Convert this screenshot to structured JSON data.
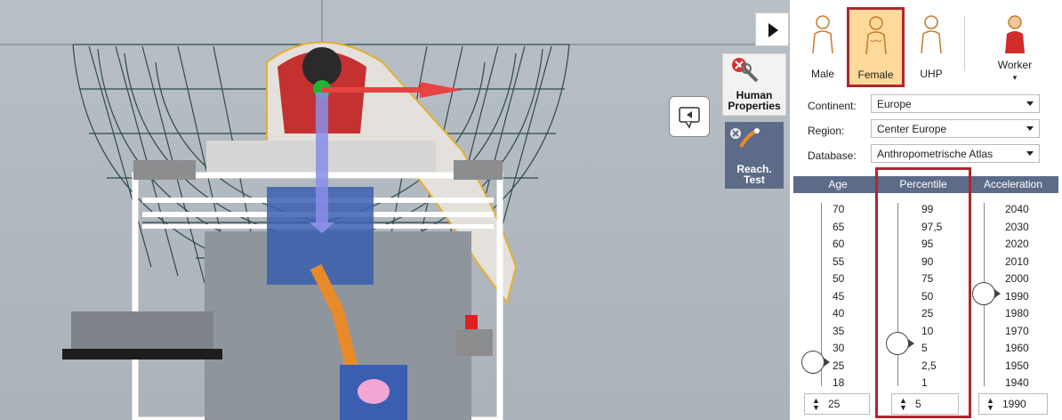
{
  "toolbar": {
    "human_properties_label": "Human Properties",
    "reach_test_label": "Reach. Test"
  },
  "gender": {
    "options": [
      "Male",
      "Female",
      "UHP",
      "Worker"
    ],
    "selected": "Female"
  },
  "continent": {
    "label": "Continent:",
    "value": "Europe"
  },
  "region": {
    "label": "Region:",
    "value": "Center Europe"
  },
  "database": {
    "label": "Database:",
    "value": "Anthropometrische Atlas"
  },
  "columns": {
    "age": {
      "title": "Age",
      "ticks": [
        "70",
        "65",
        "60",
        "55",
        "50",
        "45",
        "40",
        "35",
        "30",
        "25",
        "18"
      ],
      "value": "25"
    },
    "percentile": {
      "title": "Percentile",
      "ticks": [
        "99",
        "97,5",
        "95",
        "90",
        "75",
        "50",
        "25",
        "10",
        "5",
        "2,5",
        "1"
      ],
      "value": "5"
    },
    "acceleration": {
      "title": "Acceleration",
      "ticks": [
        "2040",
        "2030",
        "2020",
        "2010",
        "2000",
        "1990",
        "1980",
        "1970",
        "1960",
        "1950",
        "1940"
      ],
      "value": "1990"
    }
  },
  "colors": {
    "accent": "#5d6b88",
    "highlight": "#b2262c",
    "selected_bg": "#ffd99a"
  }
}
